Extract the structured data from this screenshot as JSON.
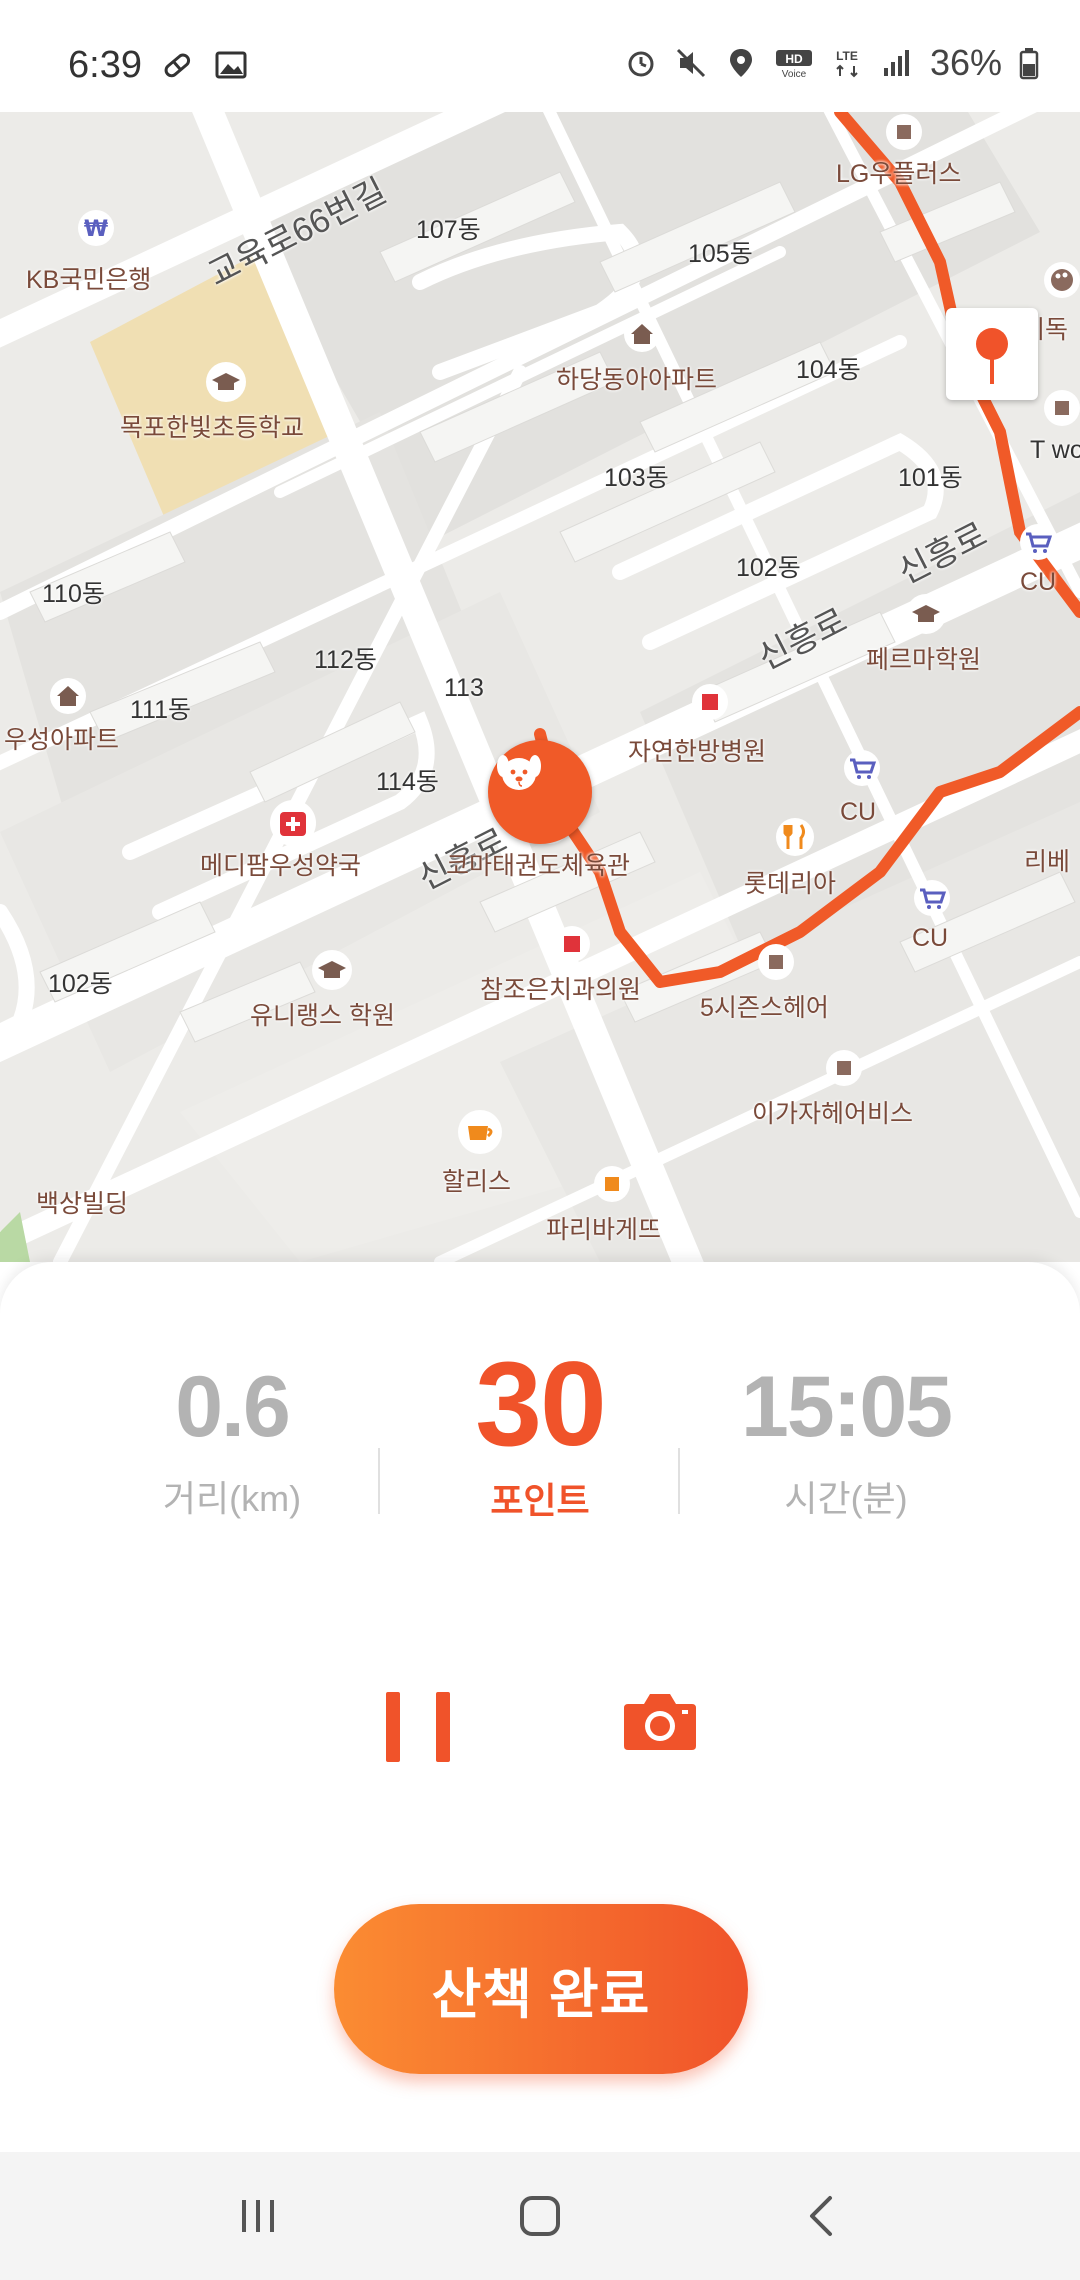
{
  "status_bar": {
    "time": "6:39",
    "battery": "36%",
    "icons": [
      "pill-icon",
      "image-icon",
      "alarm-icon",
      "mute-icon",
      "location-icon",
      "hd-voice-icon",
      "lte-icon",
      "signal-icon",
      "battery-icon"
    ]
  },
  "map": {
    "labels": {
      "kb_bank": "KB국민은행",
      "road_66": "교육로66번길",
      "b107": "107동",
      "b105": "105동",
      "lg_plaza": "LG우플러스",
      "hadang_apt": "하당동아아파트",
      "b104": "104동",
      "school": "목포한빛초등학교",
      "b103": "103동",
      "b101": "101동",
      "b102a": "102동",
      "cu1": "CU",
      "b110": "110동",
      "sinheung1": "신흥로",
      "sinheung2": "신흥로",
      "perma": "페르마학원",
      "b112": "112동",
      "b113": "113",
      "b111": "111동",
      "useong_apt": "우성아파트",
      "hospital": "자연한방병원",
      "b114": "114동",
      "sinheung3": "신흥로",
      "pharmacy": "메디팜우성약국",
      "taekwondo": "코마태권도체육관",
      "loteria": "롯데리아",
      "cu2": "CU",
      "cu3": "CU",
      "b102b": "102동",
      "dental": "참조은치과의원",
      "university": "유니랭스 학원",
      "hair5": "5시즌스헤어",
      "hairbis": "이가자헤어비스",
      "hollys": "할리스",
      "baeksang": "백상빌딩",
      "paris": "파리바게뜨",
      "hadang_gi": "하당기독",
      "ribe": "리베",
      "t_wor": "T wor"
    }
  },
  "stats": {
    "distance": {
      "value": "0.6",
      "label": "거리(km)"
    },
    "points": {
      "value": "30",
      "label": "포인트"
    },
    "time": {
      "value": "15:05",
      "label": "시간(분)"
    }
  },
  "controls": {
    "pause": "pause-icon",
    "camera": "camera-icon",
    "finish_label": "산책 완료"
  },
  "nav": [
    "recent-apps-icon",
    "home-icon",
    "back-icon"
  ],
  "colors": {
    "accent": "#f0532a",
    "accent_light": "#fb8c32",
    "route": "#f05a28",
    "muted": "#b3b3b3"
  }
}
